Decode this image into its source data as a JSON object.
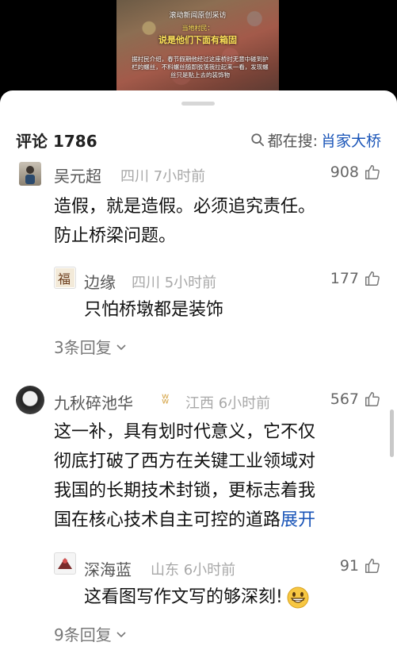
{
  "video": {
    "caption_top": "滚动新闻原创采访",
    "caption_sub": "当地村民：",
    "caption_main": "说是他们下面有箱固",
    "body_text": "据村民介绍，春节假期他经过这座桥时无意中碰到护栏的螺丝，不料螺丝随即脱落我拉起来一看，发现螺丝只是贴上去的装饰物"
  },
  "header": {
    "comment_count": "评论 1786",
    "search_label": "都在搜:",
    "search_keyword": "肖家大桥"
  },
  "comments": [
    {
      "name": "吴元超",
      "meta": "四川 7小时前",
      "likes": "908",
      "text_lines": [
        "造假，就是造假。必须追究责任。",
        "防止桥梁问题。"
      ],
      "reply": {
        "name": "边缘",
        "meta": "四川 5小时前",
        "likes": "177",
        "text": "只怕桥墩都是装饰"
      },
      "more_replies": "3条回复"
    },
    {
      "name": "九秋碎池华",
      "badge": "ʬ",
      "meta": "江西 6小时前",
      "likes": "567",
      "text_lines": [
        "这一补，具有划时代意义，它不仅",
        "彻底打破了西方在关键工业领域对",
        "我国的长期技术封锁，更标志着我",
        "国在核心技术自主可控的道路"
      ],
      "expand_label": "展开",
      "reply": {
        "name": "深海蓝",
        "meta": "山东 6小时前",
        "likes": "91",
        "text": "这看图写作文写的够深刻!"
      },
      "more_replies": "9条回复"
    }
  ],
  "colors": {
    "link": "#1a55b8",
    "meta": "#a8a8a8",
    "badge": "#d6a64a"
  }
}
